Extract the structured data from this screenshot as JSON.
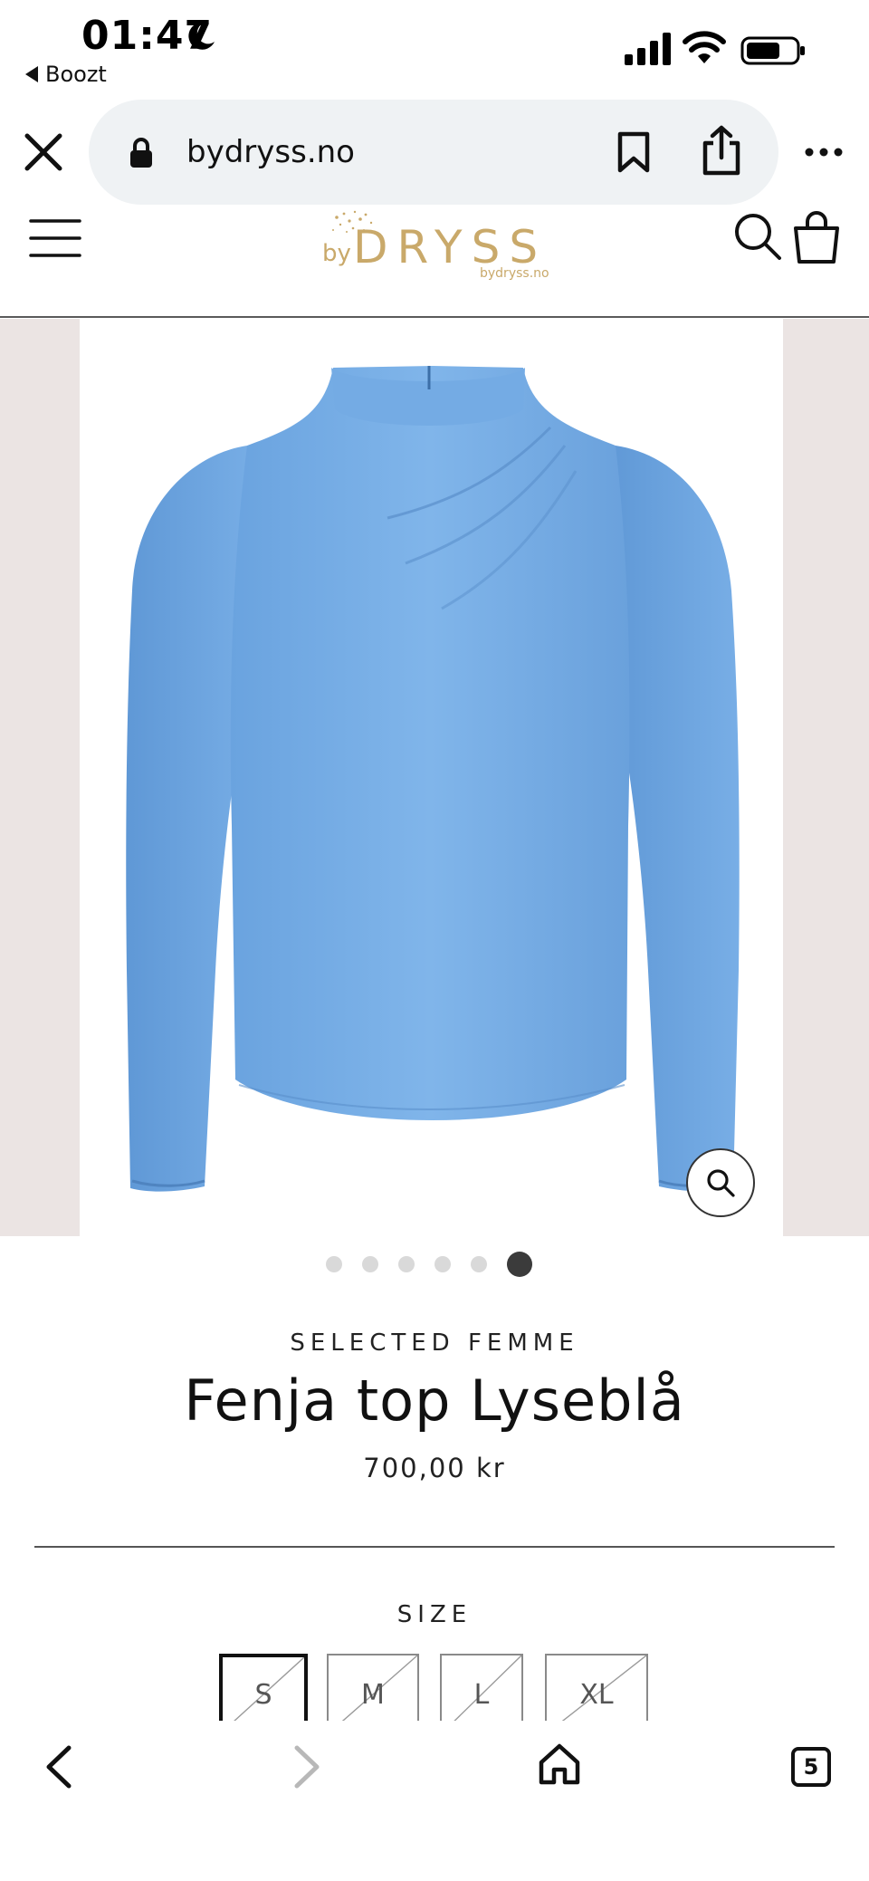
{
  "status_bar": {
    "time": "01:47",
    "back_app": "Boozt"
  },
  "browser": {
    "url": "bydryss.no",
    "open_tabs": "5"
  },
  "site": {
    "logo_text_by": "by",
    "logo_text_main": "DRYSS",
    "logo_domain": "bydryss.no"
  },
  "product": {
    "brand": "SELECTED FEMME",
    "title": "Fenja top Lyseblå",
    "price": "700,00 kr",
    "gallery": {
      "total": 6,
      "active_index": 5
    },
    "colors": {
      "top": "#78aee6",
      "bg": "#ebe4e3"
    },
    "size_label": "SIZE",
    "sizes": [
      {
        "label": "S",
        "selected": true,
        "sold_out": true
      },
      {
        "label": "M",
        "selected": false,
        "sold_out": true
      },
      {
        "label": "L",
        "selected": false,
        "sold_out": true
      },
      {
        "label": "XL",
        "selected": false,
        "sold_out": true
      }
    ]
  }
}
